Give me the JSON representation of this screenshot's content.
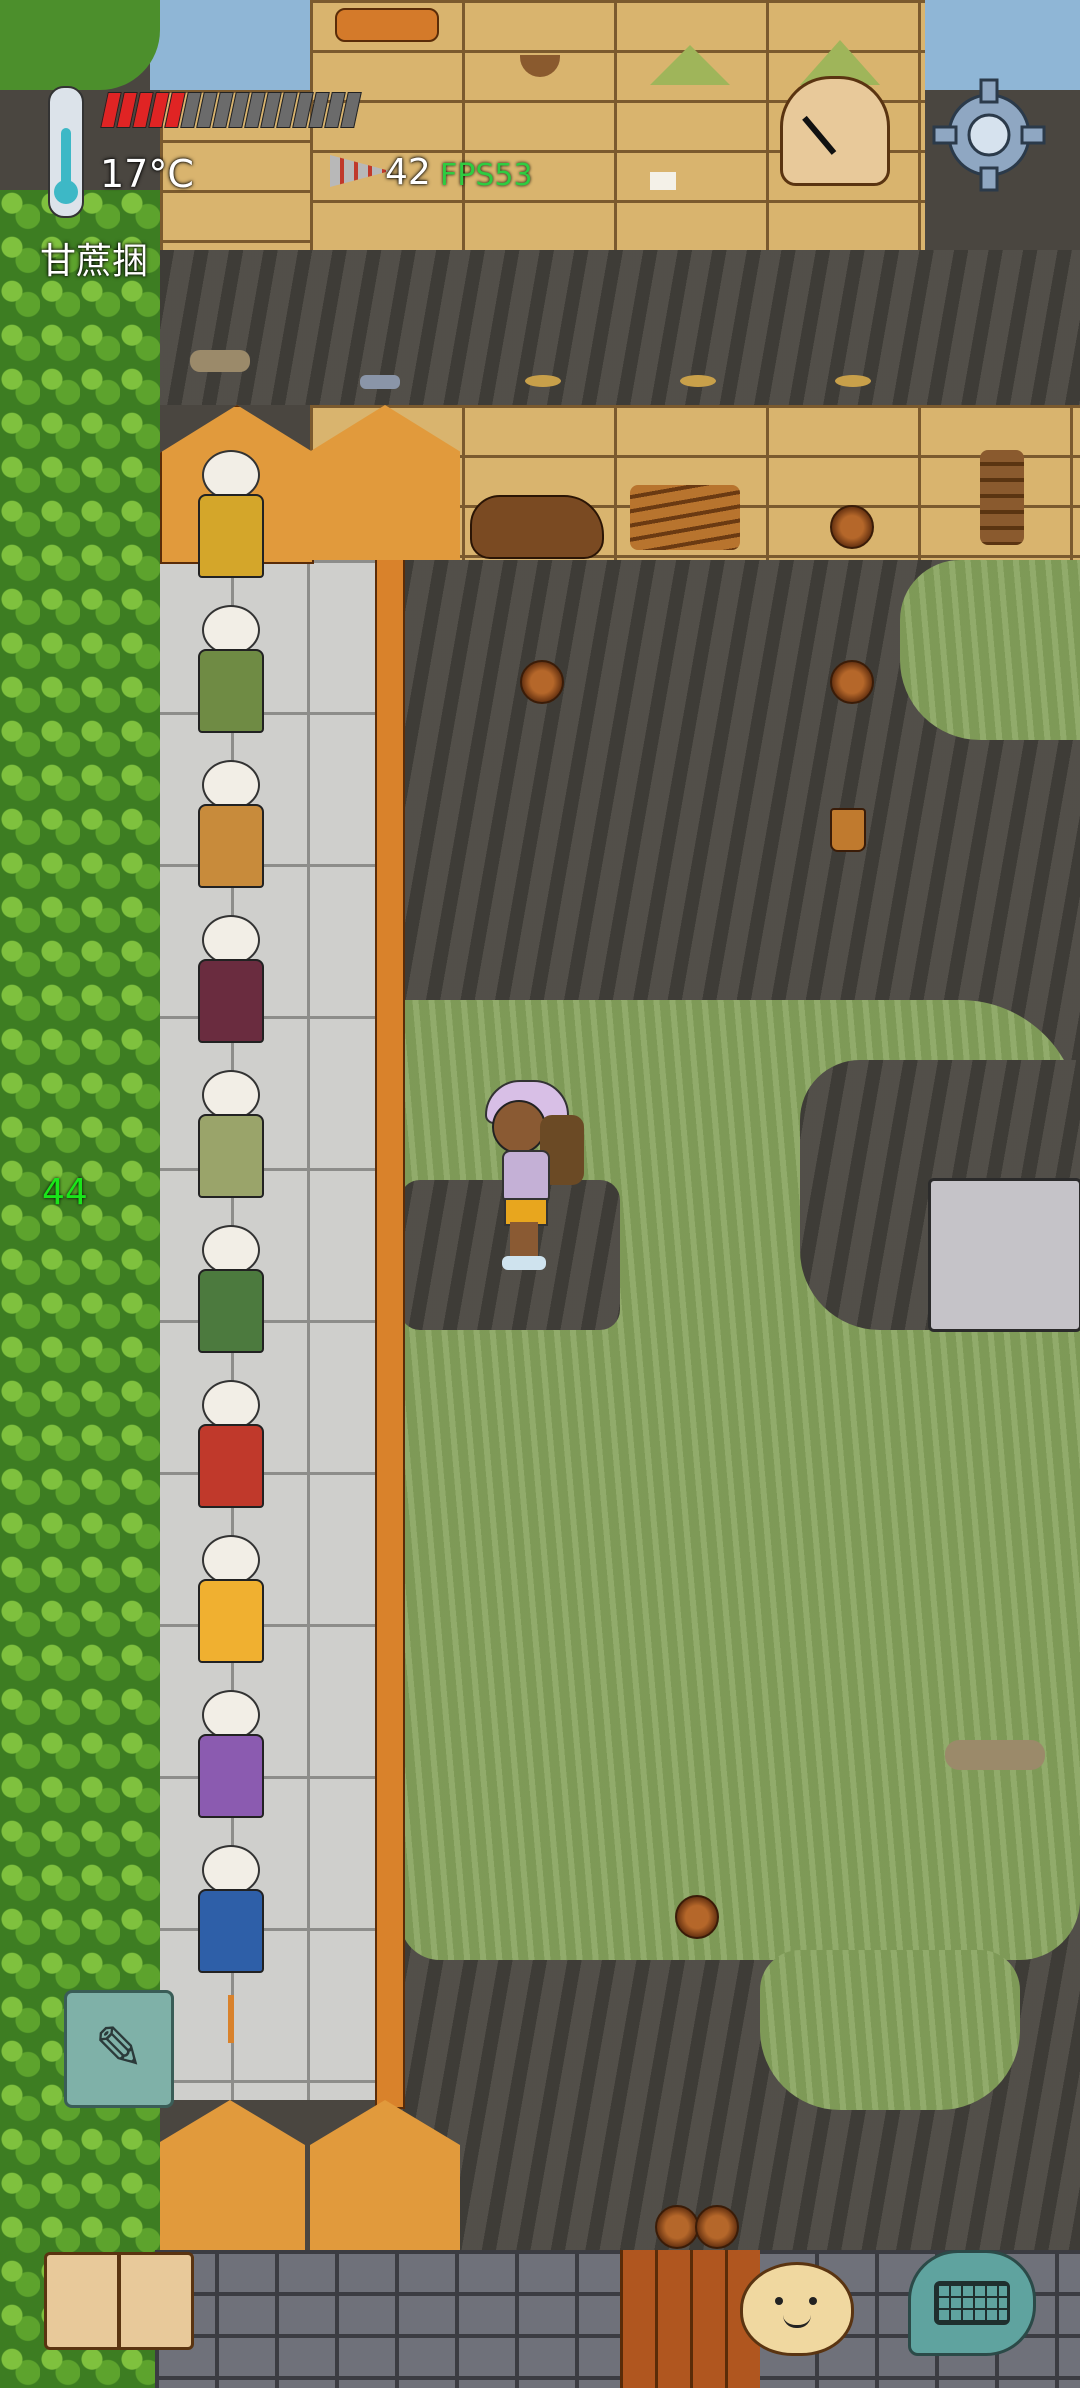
{
  "hud": {
    "temperature": "17°C",
    "food_pips_filled": 5,
    "food_pips_total": 16,
    "fps_count": "42",
    "fps_label": "FPS53",
    "held_item": "甘蔗捆",
    "side_counter": "44"
  },
  "colors": {
    "food_filled": "#e02424",
    "food_empty": "#6b6b6b",
    "fps_color": "#2ecc40",
    "counter_color": "#19e619",
    "settings_gear": "#8fa7c2",
    "keyboard_button": "#5fa39f",
    "edit_button": "#7fb1a8"
  },
  "icons": {
    "thermometer": "thermometer-icon",
    "clock": "clock-icon",
    "settings": "gear-icon",
    "edit": "pencil-icon",
    "journal": "book-icon",
    "emote": "smiley-face-icon",
    "keyboard": "keyboard-icon"
  },
  "mannequins": [
    {
      "name": "mannequin-red-hood",
      "color": "#d4a62a"
    },
    {
      "name": "mannequin-green-tunic",
      "color": "#6f8b44"
    },
    {
      "name": "mannequin-blue-patchwork",
      "color": "#c88b3b"
    },
    {
      "name": "mannequin-maroon",
      "color": "#6a2c3f"
    },
    {
      "name": "mannequin-purple-hat",
      "color": "#9aa46a"
    },
    {
      "name": "mannequin-black-hat",
      "color": "#4c7a3e"
    },
    {
      "name": "mannequin-green-hat",
      "color": "#c0392b"
    },
    {
      "name": "mannequin-straw-hat",
      "color": "#f0b030"
    },
    {
      "name": "mannequin-purple-tophat",
      "color": "#8b5bb0"
    },
    {
      "name": "mannequin-blue-hat",
      "color": "#2e5fa8"
    }
  ]
}
